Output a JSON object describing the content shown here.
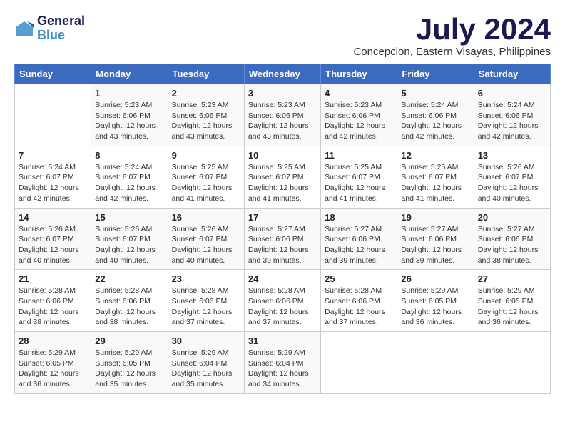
{
  "header": {
    "logo_line1": "General",
    "logo_line2": "Blue",
    "month_title": "July 2024",
    "location": "Concepcion, Eastern Visayas, Philippines"
  },
  "calendar": {
    "days_of_week": [
      "Sunday",
      "Monday",
      "Tuesday",
      "Wednesday",
      "Thursday",
      "Friday",
      "Saturday"
    ],
    "weeks": [
      [
        {
          "day": "",
          "info": ""
        },
        {
          "day": "1",
          "info": "Sunrise: 5:23 AM\nSunset: 6:06 PM\nDaylight: 12 hours\nand 43 minutes."
        },
        {
          "day": "2",
          "info": "Sunrise: 5:23 AM\nSunset: 6:06 PM\nDaylight: 12 hours\nand 43 minutes."
        },
        {
          "day": "3",
          "info": "Sunrise: 5:23 AM\nSunset: 6:06 PM\nDaylight: 12 hours\nand 43 minutes."
        },
        {
          "day": "4",
          "info": "Sunrise: 5:23 AM\nSunset: 6:06 PM\nDaylight: 12 hours\nand 42 minutes."
        },
        {
          "day": "5",
          "info": "Sunrise: 5:24 AM\nSunset: 6:06 PM\nDaylight: 12 hours\nand 42 minutes."
        },
        {
          "day": "6",
          "info": "Sunrise: 5:24 AM\nSunset: 6:06 PM\nDaylight: 12 hours\nand 42 minutes."
        }
      ],
      [
        {
          "day": "7",
          "info": ""
        },
        {
          "day": "8",
          "info": "Sunrise: 5:24 AM\nSunset: 6:07 PM\nDaylight: 12 hours\nand 42 minutes."
        },
        {
          "day": "9",
          "info": "Sunrise: 5:25 AM\nSunset: 6:07 PM\nDaylight: 12 hours\nand 41 minutes."
        },
        {
          "day": "10",
          "info": "Sunrise: 5:25 AM\nSunset: 6:07 PM\nDaylight: 12 hours\nand 41 minutes."
        },
        {
          "day": "11",
          "info": "Sunrise: 5:25 AM\nSunset: 6:07 PM\nDaylight: 12 hours\nand 41 minutes."
        },
        {
          "day": "12",
          "info": "Sunrise: 5:25 AM\nSunset: 6:07 PM\nDaylight: 12 hours\nand 41 minutes."
        },
        {
          "day": "13",
          "info": "Sunrise: 5:26 AM\nSunset: 6:07 PM\nDaylight: 12 hours\nand 40 minutes."
        }
      ],
      [
        {
          "day": "14",
          "info": "Sunrise: 5:26 AM\nSunset: 6:07 PM\nDaylight: 12 hours\nand 40 minutes."
        },
        {
          "day": "15",
          "info": "Sunrise: 5:26 AM\nSunset: 6:07 PM\nDaylight: 12 hours\nand 40 minutes."
        },
        {
          "day": "16",
          "info": "Sunrise: 5:26 AM\nSunset: 6:07 PM\nDaylight: 12 hours\nand 40 minutes."
        },
        {
          "day": "17",
          "info": "Sunrise: 5:27 AM\nSunset: 6:06 PM\nDaylight: 12 hours\nand 39 minutes."
        },
        {
          "day": "18",
          "info": "Sunrise: 5:27 AM\nSunset: 6:06 PM\nDaylight: 12 hours\nand 39 minutes."
        },
        {
          "day": "19",
          "info": "Sunrise: 5:27 AM\nSunset: 6:06 PM\nDaylight: 12 hours\nand 39 minutes."
        },
        {
          "day": "20",
          "info": "Sunrise: 5:27 AM\nSunset: 6:06 PM\nDaylight: 12 hours\nand 38 minutes."
        }
      ],
      [
        {
          "day": "21",
          "info": "Sunrise: 5:28 AM\nSunset: 6:06 PM\nDaylight: 12 hours\nand 38 minutes."
        },
        {
          "day": "22",
          "info": "Sunrise: 5:28 AM\nSunset: 6:06 PM\nDaylight: 12 hours\nand 38 minutes."
        },
        {
          "day": "23",
          "info": "Sunrise: 5:28 AM\nSunset: 6:06 PM\nDaylight: 12 hours\nand 37 minutes."
        },
        {
          "day": "24",
          "info": "Sunrise: 5:28 AM\nSunset: 6:06 PM\nDaylight: 12 hours\nand 37 minutes."
        },
        {
          "day": "25",
          "info": "Sunrise: 5:28 AM\nSunset: 6:06 PM\nDaylight: 12 hours\nand 37 minutes."
        },
        {
          "day": "26",
          "info": "Sunrise: 5:29 AM\nSunset: 6:05 PM\nDaylight: 12 hours\nand 36 minutes."
        },
        {
          "day": "27",
          "info": "Sunrise: 5:29 AM\nSunset: 6:05 PM\nDaylight: 12 hours\nand 36 minutes."
        }
      ],
      [
        {
          "day": "28",
          "info": "Sunrise: 5:29 AM\nSunset: 6:05 PM\nDaylight: 12 hours\nand 36 minutes."
        },
        {
          "day": "29",
          "info": "Sunrise: 5:29 AM\nSunset: 6:05 PM\nDaylight: 12 hours\nand 35 minutes."
        },
        {
          "day": "30",
          "info": "Sunrise: 5:29 AM\nSunset: 6:04 PM\nDaylight: 12 hours\nand 35 minutes."
        },
        {
          "day": "31",
          "info": "Sunrise: 5:29 AM\nSunset: 6:04 PM\nDaylight: 12 hours\nand 34 minutes."
        },
        {
          "day": "",
          "info": ""
        },
        {
          "day": "",
          "info": ""
        },
        {
          "day": "",
          "info": ""
        }
      ]
    ]
  }
}
